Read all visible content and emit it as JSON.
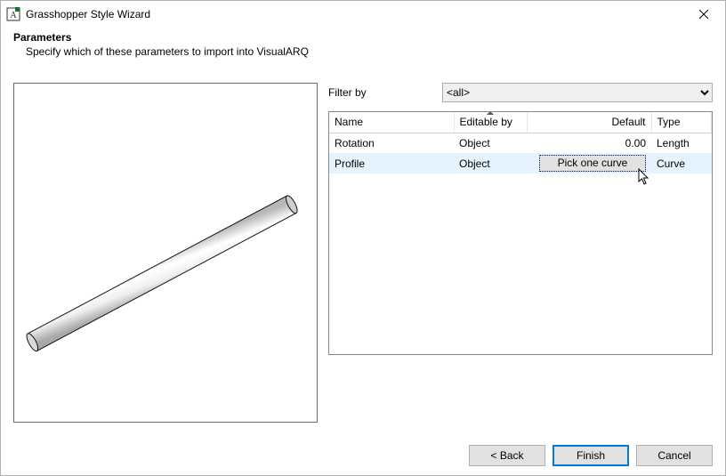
{
  "window": {
    "title": "Grasshopper Style Wizard"
  },
  "header": {
    "title": "Parameters",
    "subtitle": "Specify which of these parameters to import into VisualARQ"
  },
  "filter": {
    "label": "Filter by",
    "selected": "<all>"
  },
  "columns": {
    "name": "Name",
    "editable": "Editable by",
    "default": "Default",
    "type": "Type"
  },
  "rows": [
    {
      "name": "Rotation",
      "editable": "Object",
      "default_num": "0.00",
      "default_btn": null,
      "type": "Length",
      "selected": false
    },
    {
      "name": "Profile",
      "editable": "Object",
      "default_num": null,
      "default_btn": "Pick one curve",
      "type": "Curve",
      "selected": true
    }
  ],
  "pick_button_label": "Pick one curve",
  "footer": {
    "back": "< Back",
    "finish": "Finish",
    "cancel": "Cancel"
  }
}
